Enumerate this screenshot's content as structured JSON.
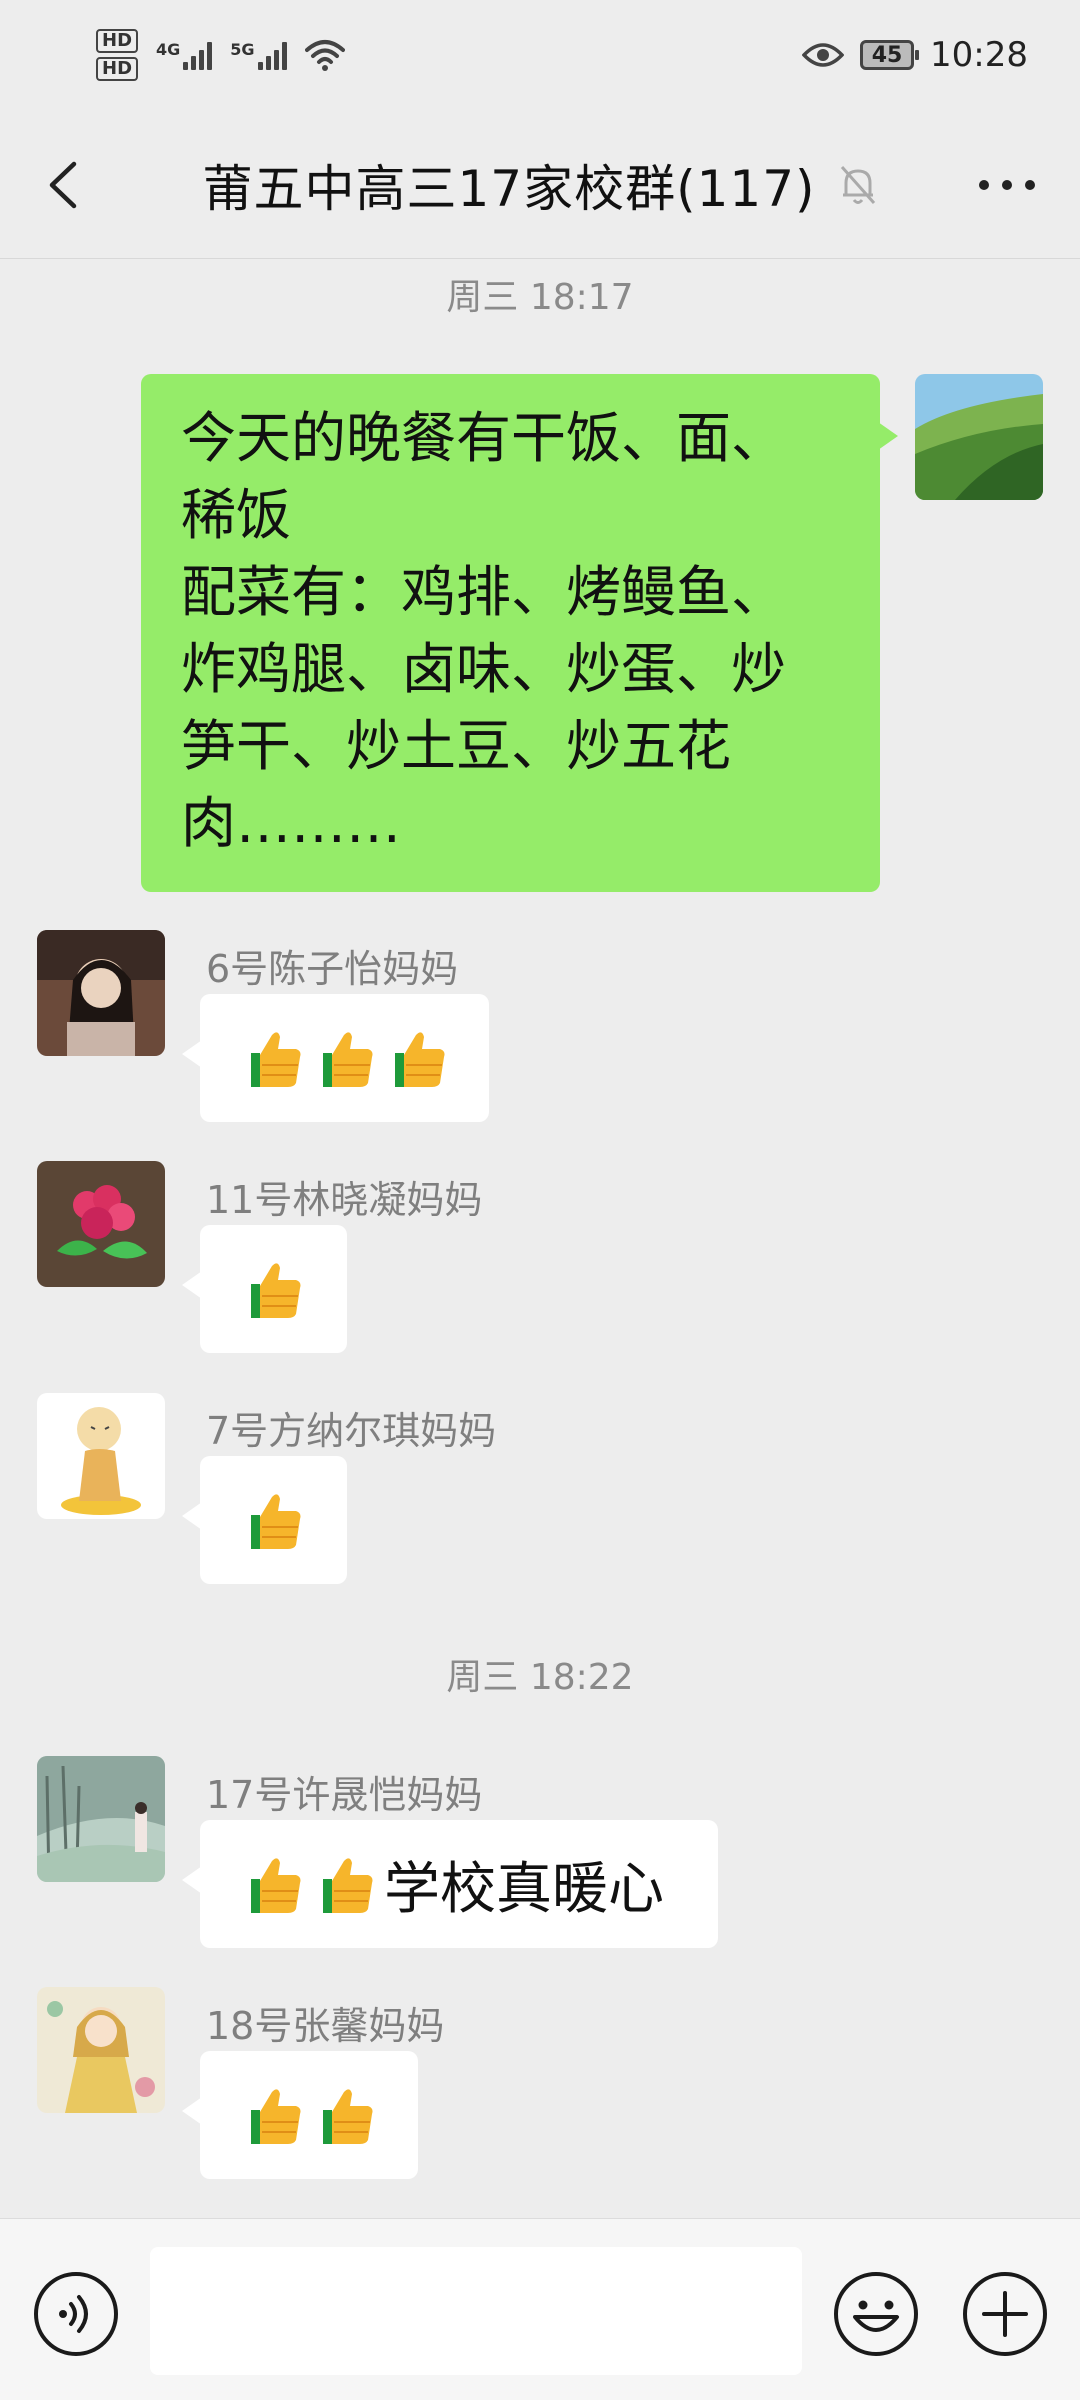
{
  "status_bar": {
    "time": "10:28",
    "battery": "45",
    "sim1_network": "4G",
    "sim2_network": "5G",
    "hd_label": "HD"
  },
  "header": {
    "title": "莆五中高三17家校群(117)"
  },
  "messages": [
    {
      "type": "timestamp",
      "text": "周三 18:17"
    },
    {
      "type": "outgoing",
      "text": "今天的晚餐有干饭、面、\n稀饭\n配菜有：鸡排、烤鳗鱼、\n炸鸡腿、卤味、炒蛋、炒\n笋干、炒土豆、炒五花\n肉………"
    },
    {
      "type": "incoming",
      "sender": "6号陈子怡妈妈",
      "thumbs": 3,
      "text": ""
    },
    {
      "type": "incoming",
      "sender": "11号林晓凝妈妈",
      "thumbs": 1,
      "text": ""
    },
    {
      "type": "incoming",
      "sender": "7号方纳尔琪妈妈",
      "thumbs": 1,
      "text": ""
    },
    {
      "type": "timestamp",
      "text": "周三 18:22"
    },
    {
      "type": "incoming",
      "sender": "17号许晟恺妈妈",
      "thumbs": 2,
      "text": "学校真暖心"
    },
    {
      "type": "incoming",
      "sender": "18号张馨妈妈",
      "thumbs": 2,
      "text": ""
    }
  ],
  "input_bar": {
    "placeholder": ""
  }
}
